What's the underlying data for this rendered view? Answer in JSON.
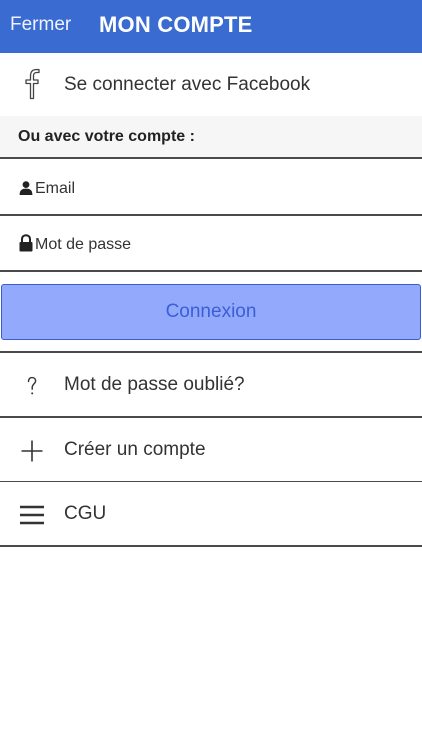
{
  "header": {
    "close_label": "Fermer",
    "title": "MON COMPTE",
    "background_color": "#3a6bd1"
  },
  "facebook": {
    "icon": "facebook-f-icon",
    "label": "Se connecter avec Facebook"
  },
  "section": {
    "heading": "Ou avec votre compte :"
  },
  "form": {
    "email": {
      "icon": "user-icon",
      "placeholder": "Email",
      "value": ""
    },
    "password": {
      "icon": "lock-icon",
      "placeholder": "Mot de passe",
      "value": ""
    },
    "submit_label": "Connexion",
    "submit_color": "#93a9fb"
  },
  "menu": {
    "items": [
      {
        "icon": "question-icon",
        "label": "Mot de passe oublié?"
      },
      {
        "icon": "plus-icon",
        "label": "Créer un compte"
      },
      {
        "icon": "menu-lines-icon",
        "label": "CGU"
      }
    ]
  }
}
